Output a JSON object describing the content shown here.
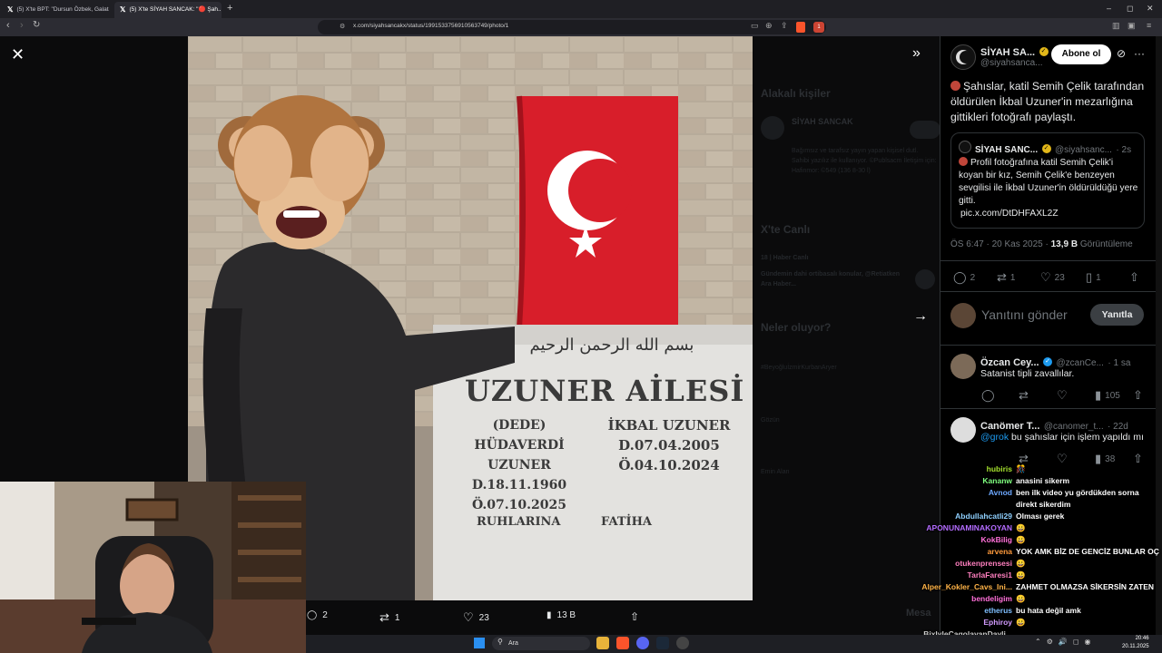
{
  "browser": {
    "tabs": [
      {
        "title": "(5) X'te BPT: \"Dursun Özbek, Galatasa...",
        "active": false
      },
      {
        "title": "(5) X'te SİYAH SANCAK: \"🔴 Şah...",
        "active": true
      }
    ],
    "url": "x.com/siyahsancakx/status/1991533756910563749/photo/1",
    "notification_count": "1"
  },
  "viewer": {
    "stone": {
      "basmala": "بسم الله الرحمن الرحيم",
      "family": "UZUNER AİLESİ",
      "left_role": "(DEDE)",
      "left_name1": "HÜDAVERDİ",
      "left_name2": "UZUNER",
      "left_birth": "D.18.11.1960",
      "left_death": "Ö.07.10.2025",
      "right_name": "İKBAL UZUNER",
      "right_birth": "D.07.04.2005",
      "right_death": "Ö.04.10.2024",
      "footer": "RUHLARINA FATİHA"
    },
    "actions": {
      "replies": "2",
      "reposts": "1",
      "likes": "23",
      "views": "13 B"
    },
    "ghost": {
      "related": "Alakalı kişiler",
      "related_name": "SİYAH SANCAK",
      "related_bio": "Bağımsız ve tarafsız yayın yapan kişisel dutl. Sahibi yazılız ile kullanıyor. ©Publsacm İletişim için: Hafinmor: ©549 (136 8-30 l)",
      "live": "X'te Canlı",
      "live_name": "18 | Haber Canlı",
      "live_text": "Gündemin dahi ortibasalı konular, @Retiatken Ara Haber...",
      "happening": "Neler oluyor?",
      "trend1": "#BeyoğluİzmirKurbanAryer",
      "trend2": "Gözün",
      "trend3": "Emin Alan",
      "more": "Mesa"
    }
  },
  "tweet": {
    "author_name": "SİYAH SA...",
    "author_handle": "@siyahsanca...",
    "follow_label": "Abone ol",
    "text": "Şahıslar, katil Semih Çelik tarafından öldürülen İkbal Uzuner'in mezarlığına gittikleri fotoğrafı paylaştı.",
    "quote": {
      "name": "SİYAH SANC...",
      "handle": "@siyahsanc...",
      "time": "· 2s",
      "text": "Profil fotoğrafına katil Semih Çelik'i koyan bir kız, Semih Çelik'e benzeyen sevgilisi ile İkbal Uzuner'in öldürüldüğü yere gitti.",
      "link": "pic.x.com/DtDHFAXL2Z"
    },
    "time": "ÖS 6:47 · 20 Kas 2025 · ",
    "views": "13,9 B",
    "views_label": " Görüntüleme",
    "stats": {
      "replies": "2",
      "reposts": "1",
      "likes": "23",
      "bookmarks": "1"
    },
    "reply_placeholder": "Yanıtını gönder",
    "reply_button": "Yanıtla"
  },
  "replies": [
    {
      "name": "Özcan Cey...",
      "handle": "@zcanCe...",
      "time": "· 1 sa",
      "text": "Satanist tipli zavallılar.",
      "views": "105"
    },
    {
      "name": "Canömer T...",
      "handle": "@canomer_t...",
      "time": "· 22d",
      "mention": "@grok",
      "text": " bu şahıslar için işlem yapıldı mı",
      "views": "38"
    }
  ],
  "chat": [
    {
      "user": "hubiris",
      "color": "#a6e22e",
      "msg": "🎊"
    },
    {
      "user": "Kananw",
      "color": "#7fff7f",
      "msg": "anasini sikerm"
    },
    {
      "user": "Avnod",
      "color": "#6da8ff",
      "msg": "ben ilk video yu gördükden sorna"
    },
    {
      "user": "",
      "color": "#6da8ff",
      "msg": "direkt sikerdim"
    },
    {
      "user": "Abdullahcatli29",
      "color": "#8fd0ff",
      "msg": "Olması gerek"
    },
    {
      "user": "APONUNAMINAKOYAN",
      "color": "#b46cff",
      "msg": "😀"
    },
    {
      "user": "KokBilig",
      "color": "#ff6fd8",
      "msg": "😀"
    },
    {
      "user": "arvena",
      "color": "#ff9a3c",
      "msg": "YOK AMK BİZ DE GENCİZ BUNLAR OÇ"
    },
    {
      "user": "otukenprensesi",
      "color": "#ff7fbf",
      "msg": "😀"
    },
    {
      "user": "TarlaFaresi1",
      "color": "#ff7fbf",
      "msg": "😀"
    },
    {
      "user": "Alper_Kokler_Cavs_Ini...",
      "color": "#ffb347",
      "msg": "ZAHMET OLMAZSA SİKERSİN ZATEN"
    },
    {
      "user": "bendeligim",
      "color": "#ff6fd8",
      "msg": "😀"
    },
    {
      "user": "etherus",
      "color": "#7fbfff",
      "msg": "bu hata değil amk"
    },
    {
      "user": "Ephiroy",
      "color": "#d29bff",
      "msg": "😀"
    },
    {
      "user": "BixlyleCagolayanDayli...",
      "color": "#cccccc",
      "msg": ""
    }
  ],
  "taskbar": {
    "search_placeholder": "Ara",
    "time": "20:46",
    "date": "20.11.2025"
  },
  "colors": {
    "accent": "#1d9bf0",
    "flag_red": "#d81e2a"
  }
}
